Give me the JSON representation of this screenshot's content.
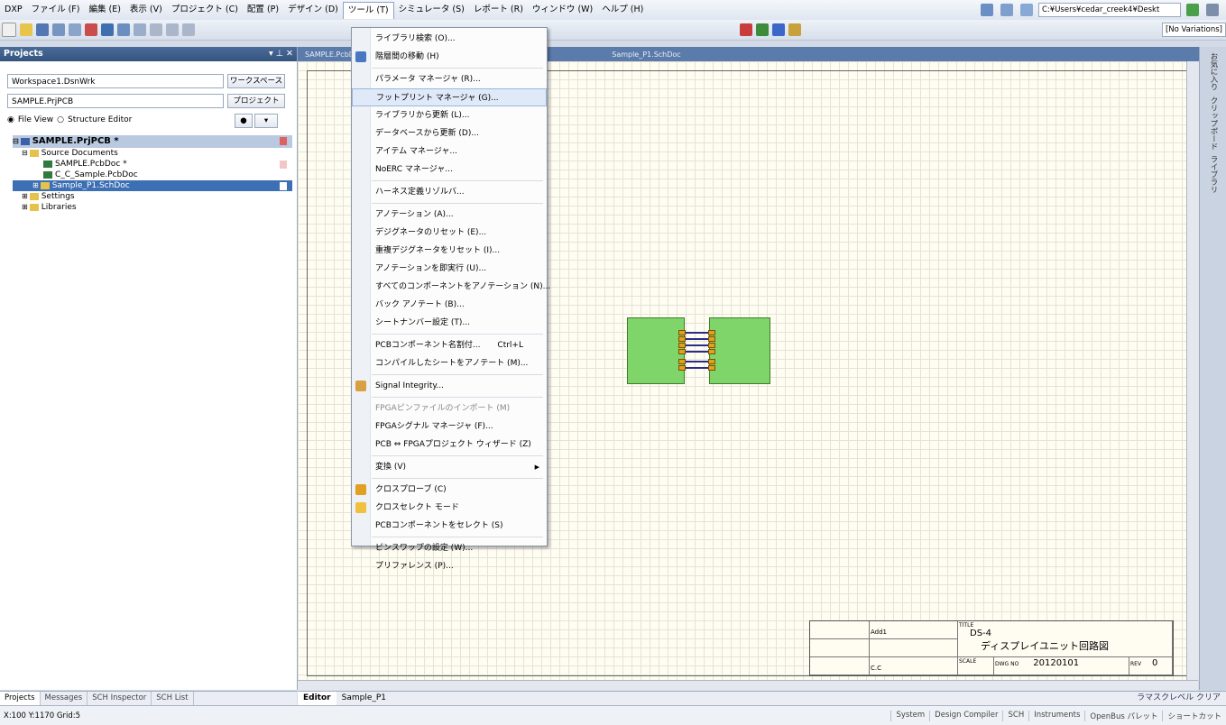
{
  "menubar": {
    "items": [
      "DXP",
      "ファイル (F)",
      "編集 (E)",
      "表示 (V)",
      "プロジェクト (C)",
      "配置 (P)",
      "デザイン (D)",
      "ツール (T)",
      "シミュレータ (S)",
      "レポート (R)",
      "ウィンドウ (W)",
      "ヘルプ (H)"
    ],
    "path": "C:¥Users¥cedar_creek4¥Deskt"
  },
  "toolbar": {
    "variations": "[No Variations]"
  },
  "projects": {
    "title": "Projects",
    "workspace": "Workspace1.DsnWrk",
    "workspace_btn": "ワークスペース",
    "project": "SAMPLE.PrjPCB",
    "project_btn": "プロジェクト",
    "file_view": "File View",
    "structure_editor": "Structure Editor",
    "tree": [
      {
        "label": "SAMPLE.PrjPCB *",
        "level": 0,
        "type": "project"
      },
      {
        "label": "Source Documents",
        "level": 1,
        "type": "folder"
      },
      {
        "label": "SAMPLE.PcbDoc *",
        "level": 2,
        "type": "pcb"
      },
      {
        "label": "C_C_Sample.PcbDoc",
        "level": 2,
        "type": "pcb"
      },
      {
        "label": "Sample_P1.SchDoc",
        "level": 2,
        "type": "sch"
      },
      {
        "label": "Settings",
        "level": 1,
        "type": "folder"
      },
      {
        "label": "Libraries",
        "level": 1,
        "type": "folder"
      }
    ],
    "tabs": [
      "Projects",
      "Messages",
      "SCH Inspector",
      "SCH List"
    ]
  },
  "document_tabs": [
    "SAMPLE.PcbDoc",
    "Sample_P1.SchDoc"
  ],
  "editor_tabs": [
    "Editor",
    "Sample_P1"
  ],
  "right_panels": [
    "お気に入り",
    "クリップボード",
    "ライブラリ"
  ],
  "tools_menu": {
    "items": [
      {
        "label": "ライブラリ検索 (O)..."
      },
      {
        "label": "階層間の移動 (H)",
        "icon": "hierarchy-icon"
      },
      {
        "sep": true
      },
      {
        "label": "パラメータ マネージャ (R)..."
      },
      {
        "label": "フットプリント マネージャ (G)...",
        "highlight": true
      },
      {
        "label": "ライブラリから更新 (L)..."
      },
      {
        "label": "データベースから更新 (D)..."
      },
      {
        "label": "アイテム マネージャ..."
      },
      {
        "label": "NoERC マネージャ..."
      },
      {
        "sep": true
      },
      {
        "label": "ハーネス定義リゾルバ..."
      },
      {
        "sep": true
      },
      {
        "label": "アノテーション (A)..."
      },
      {
        "label": "デジグネータのリセット (E)..."
      },
      {
        "label": "重複デジグネータをリセット (I)..."
      },
      {
        "label": "アノテーションを即実行 (U)..."
      },
      {
        "label": "すべてのコンポーネントをアノテーション (N)..."
      },
      {
        "label": "バック アノテート (B)..."
      },
      {
        "label": "シートナンバー設定 (T)..."
      },
      {
        "sep": true
      },
      {
        "label": "PCBコンポーネント名割付...",
        "shortcut": "Ctrl+L"
      },
      {
        "label": "コンパイルしたシートをアノテート (M)..."
      },
      {
        "sep": true
      },
      {
        "label": "Signal Integrity...",
        "icon": "signal-integrity-icon"
      },
      {
        "sep": true
      },
      {
        "label": "FPGAピンファイルのインポート (M)",
        "disabled": true
      },
      {
        "label": "FPGAシグナル マネージャ (F)..."
      },
      {
        "label": "PCB ⇔ FPGAプロジェクト ウィザード (Z)"
      },
      {
        "sep": true
      },
      {
        "label": "変換 (V)",
        "submenu": true
      },
      {
        "sep": true
      },
      {
        "label": "クロスプローブ (C)",
        "icon": "probe-icon"
      },
      {
        "label": "クロスセレクト モード",
        "icon": "cross-select-icon"
      },
      {
        "label": "PCBコンポーネントをセレクト (S)"
      },
      {
        "sep": true
      },
      {
        "label": "ピンスワップの設定 (W)..."
      },
      {
        "label": "プリファレンス (P)..."
      }
    ]
  },
  "titleblock": {
    "title_label": "TITLE",
    "title_code": "DS-4",
    "title_name": "ディスプレイユニット回路図",
    "scale_label": "SCALE",
    "dwg_label": "DWG NO",
    "dwg_no": "20120101",
    "rev_label": "REV",
    "rev": "0",
    "designer": "C.C",
    "spec": "Add1"
  },
  "bottom_right": "ラマスクレベル クリア",
  "status": {
    "coords": "X:100 Y:1170   Grid:5",
    "items": [
      "System",
      "Design Compiler",
      "SCH",
      "Instruments",
      "OpenBus パレット",
      "ショートカット"
    ]
  },
  "colors": {
    "highlight": "#dfe9f7",
    "selection": "#3d6fb4",
    "block": "#7fd46a"
  }
}
